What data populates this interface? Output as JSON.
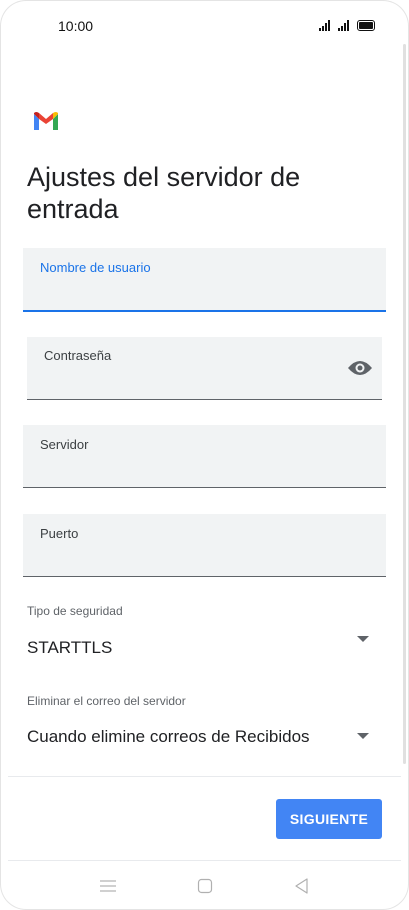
{
  "status_bar": {
    "time": "10:00"
  },
  "app": {
    "logo": "gmail-icon"
  },
  "page": {
    "title": "Ajustes del servidor de entrada"
  },
  "form": {
    "username": {
      "label": "Nombre de usuario",
      "value": ""
    },
    "password": {
      "label": "Contraseña",
      "value": "",
      "icon": "eye-icon"
    },
    "server": {
      "label": "Servidor",
      "value": ""
    },
    "port": {
      "label": "Puerto",
      "value": ""
    },
    "security": {
      "label": "Tipo de seguridad",
      "value": "STARTTLS"
    },
    "delete_mail": {
      "label": "Eliminar el correo del servidor",
      "value": "Cuando elimine correos de Recibidos"
    }
  },
  "footer": {
    "next_label": "SIGUIENTE"
  },
  "colors": {
    "accent": "#1a73e8",
    "button": "#4285f4",
    "field_bg": "#f1f3f4"
  },
  "navigation": {
    "icons": [
      "menu-icon",
      "home-icon",
      "back-icon"
    ]
  }
}
